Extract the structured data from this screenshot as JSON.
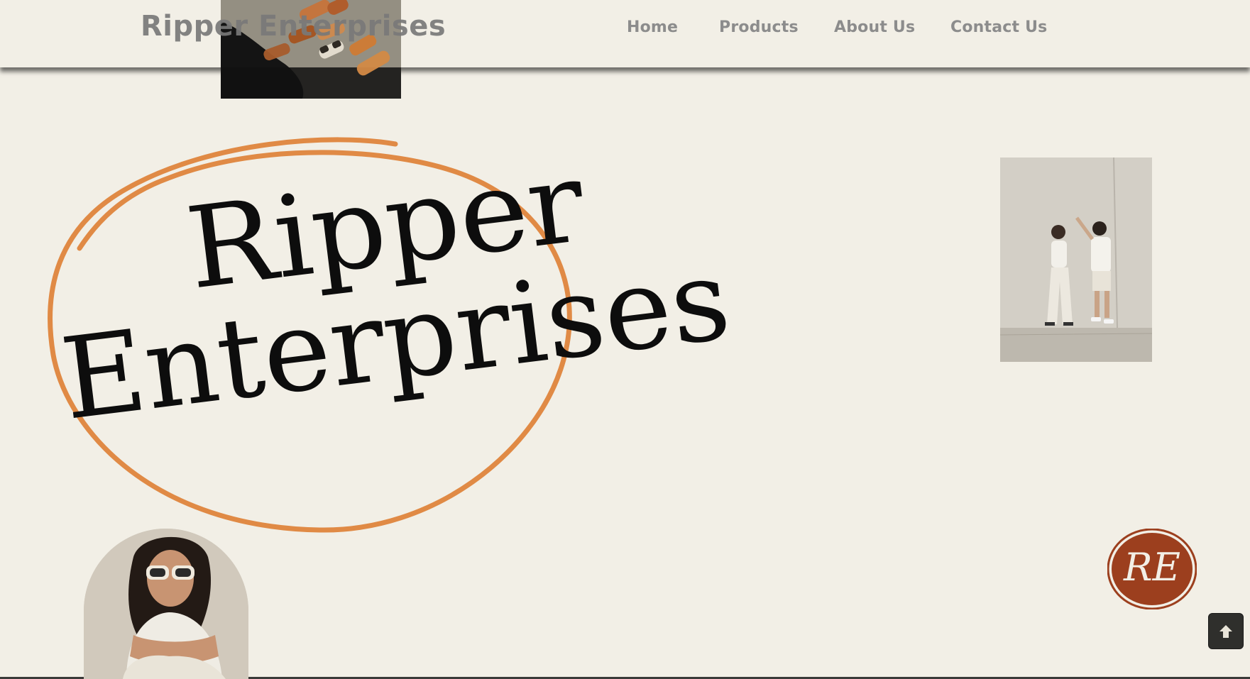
{
  "header": {
    "brand": "Ripper Enterprises",
    "nav": [
      {
        "label": "Home"
      },
      {
        "label": "Products"
      },
      {
        "label": "About Us"
      },
      {
        "label": "Contact Us"
      }
    ]
  },
  "hero": {
    "logo_line1": "Ripper",
    "logo_line2": "Enterprises",
    "accent_color": "#e08a45"
  },
  "badge": {
    "monogram": "RE",
    "color": "#9c3f1e"
  },
  "icons": {
    "back_to_top": "arrow-up-icon"
  }
}
